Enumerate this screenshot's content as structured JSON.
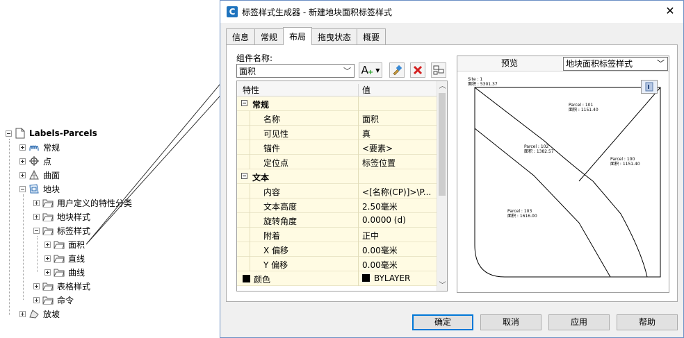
{
  "tree": {
    "root": "Labels-Parcels",
    "items": [
      {
        "label": "常规"
      },
      {
        "label": "点"
      },
      {
        "label": "曲面"
      },
      {
        "label": "地块"
      },
      {
        "label": "用户定义的特性分类"
      },
      {
        "label": "地块样式"
      },
      {
        "label": "标签样式"
      },
      {
        "label": "面积"
      },
      {
        "label": "直线"
      },
      {
        "label": "曲线"
      },
      {
        "label": "表格样式"
      },
      {
        "label": "命令"
      },
      {
        "label": "放坡"
      }
    ]
  },
  "dialog": {
    "app_icon_letter": "C",
    "title": "标签样式生成器 - 新建地块面积标签样式",
    "tabs": [
      {
        "label": "信息"
      },
      {
        "label": "常规"
      },
      {
        "label": "布局"
      },
      {
        "label": "拖曳状态"
      },
      {
        "label": "概要"
      }
    ],
    "active_tab": "布局",
    "component_name_label": "组件名称:",
    "component_name_value": "面积",
    "toolbar": {
      "add_component_glyph": "A",
      "add_badge": "+",
      "copy_icon": "paint-brush-icon",
      "delete_icon": "red-x-icon",
      "order_icon": "component-order-icon"
    },
    "grid": {
      "header_property": "特性",
      "header_value": "值",
      "sections": [
        {
          "category": "常规",
          "rows": [
            {
              "name": "名称",
              "value": "面积"
            },
            {
              "name": "可见性",
              "value": "真"
            },
            {
              "name": "锚件",
              "value": "<要素>"
            },
            {
              "name": "定位点",
              "value": "标签位置"
            }
          ]
        },
        {
          "category": "文本",
          "rows": [
            {
              "name": "内容",
              "value": "<[名称(CP)]>\\P..."
            },
            {
              "name": "文本高度",
              "value": "2.50毫米"
            },
            {
              "name": "旋转角度",
              "value": "0.0000 (d)"
            },
            {
              "name": "附着",
              "value": "正中"
            },
            {
              "name": "X 偏移",
              "value": "0.00毫米"
            },
            {
              "name": "Y 偏移",
              "value": "0.00毫米"
            },
            {
              "name": "颜色",
              "value": "BYLAYER"
            }
          ]
        }
      ]
    },
    "preview": {
      "label": "预览",
      "style_select": "地块面积标签样式",
      "labels": [
        {
          "name": "Site : 1",
          "area": "面积 : 5301.37"
        },
        {
          "name": "Parcel : 101",
          "area": "面积 : 1151.40"
        },
        {
          "name": "Parcel : 102",
          "area": "面积 : 1382.57"
        },
        {
          "name": "Parcel : 100",
          "area": "面积 : 1151.40"
        },
        {
          "name": "Parcel : 103",
          "area": "面积 : 1616.00"
        }
      ]
    },
    "buttons": {
      "ok": "确定",
      "cancel": "取消",
      "apply": "应用",
      "help": "帮助"
    },
    "close_glyph": "✕"
  }
}
